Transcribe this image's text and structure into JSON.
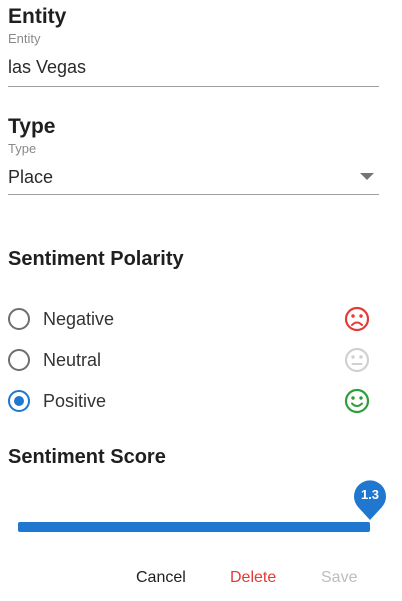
{
  "entity": {
    "heading": "Entity",
    "small_label": "Entity",
    "value": "las Vegas"
  },
  "type": {
    "heading": "Type",
    "small_label": "Type",
    "selected": "Place"
  },
  "sentiment_polarity": {
    "title": "Sentiment Polarity",
    "options": [
      {
        "label": "Negative",
        "icon": "sad-face-icon",
        "color": "#e53935",
        "checked": false
      },
      {
        "label": "Neutral",
        "icon": "neutral-face-icon",
        "color": "#d0d0d0",
        "checked": false
      },
      {
        "label": "Positive",
        "icon": "happy-face-icon",
        "color": "#2e9e3a",
        "checked": true
      }
    ]
  },
  "sentiment_score": {
    "title": "Sentiment Score",
    "value_label": "1.3",
    "fill_fraction": 1.0,
    "color": "#1f77d0"
  },
  "actions": {
    "cancel": "Cancel",
    "delete": "Delete",
    "save": "Save"
  },
  "colors": {
    "accent": "#1f77d0",
    "delete": "#e53935",
    "disabled": "#bdbdbd"
  }
}
